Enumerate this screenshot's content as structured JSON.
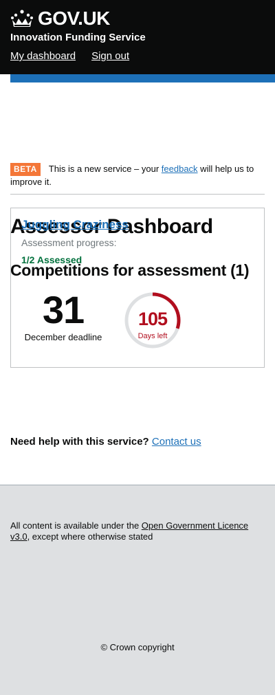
{
  "header": {
    "logo_text": "GOV.UK",
    "service_name": "Innovation Funding Service",
    "nav": [
      {
        "label": "My dashboard"
      },
      {
        "label": "Sign out"
      }
    ]
  },
  "phase_banner": {
    "tag": "BETA",
    "text_before": "This is a new service – your ",
    "link_text": "feedback",
    "text_after": " will help us to improve it."
  },
  "page": {
    "title": "Assessor Dashboard",
    "section_title": "Competitions for assessment (1)"
  },
  "competition": {
    "name": "Juggling Craziness",
    "progress_label": "Assessment progress:",
    "progress_value": "1/2 Assessed",
    "deadline_day": "31",
    "deadline_month": "December deadline",
    "days_left_number": "105",
    "days_left_label": "Days left",
    "days_left_fraction": 0.3
  },
  "help": {
    "text": "Need help with this service?",
    "link": "Contact us"
  },
  "footer": {
    "licence_before": "All content is available under the ",
    "licence_link": "Open Government Licence v3.0",
    "licence_after": ", except where otherwise stated",
    "copyright": "© Crown copyright"
  },
  "colors": {
    "header_bg": "#0b0c0c",
    "link_blue": "#1d70b8",
    "beta_orange": "#f47738",
    "assessed_green": "#00703c",
    "days_left_red": "#b10e1e",
    "footer_bg": "#dee0e2"
  }
}
